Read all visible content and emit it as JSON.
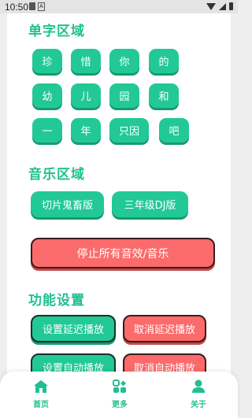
{
  "status_bar": {
    "time": "10:50",
    "notification_icon_label": "A"
  },
  "sections": {
    "single_char": {
      "title": "单字区域",
      "chips": [
        "珍",
        "惜",
        "你",
        "的",
        "幼",
        "儿",
        "园",
        "和",
        "一",
        "年",
        "只因",
        "吧"
      ]
    },
    "music": {
      "title": "音乐区域",
      "buttons": [
        "切片鬼畜版",
        "三年级DJ版"
      ],
      "stop_button": "停止所有音效/音乐"
    },
    "settings": {
      "title": "功能设置",
      "buttons": [
        "设置延迟播放",
        "取消延迟播放",
        "设置自动播放",
        "取消自动播放"
      ]
    }
  },
  "bottom_nav": {
    "items": [
      {
        "label": "首页",
        "icon": "home-icon"
      },
      {
        "label": "更多",
        "icon": "more-icon"
      },
      {
        "label": "关于",
        "icon": "user-icon"
      }
    ]
  },
  "colors": {
    "accent": "#22c997",
    "title": "#20c090",
    "danger": "#fb6b6b"
  }
}
